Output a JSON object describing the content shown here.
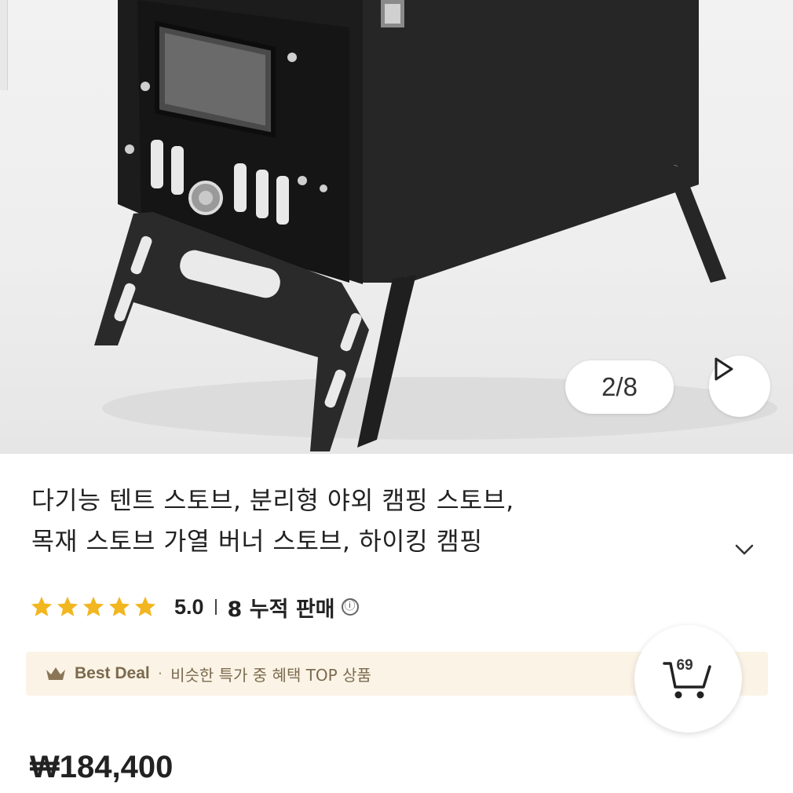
{
  "gallery": {
    "counter": "2/8",
    "next_icon": "play-next-icon"
  },
  "product": {
    "title_line1": "다기능 텐트 스토브, 분리형 야외 캠핑 스토브,",
    "title_line2": "목재 스토브 가열 버너 스토브, 하이킹 캠핑",
    "expand_icon": "chevron-down-icon",
    "rating_value": "5.0",
    "rating_stars": 5,
    "sales_text": "8 누적 판매",
    "info_icon": "ⓘ",
    "price": "₩184,400"
  },
  "deal": {
    "label": "Best Deal",
    "separator": "·",
    "text": "비슷한 특가 중 혜택 TOP 상품"
  },
  "cart": {
    "count": "69"
  },
  "colors": {
    "star": "#f2b620",
    "banner_bg": "#fbf4e6",
    "banner_text": "#7b6a4e"
  }
}
